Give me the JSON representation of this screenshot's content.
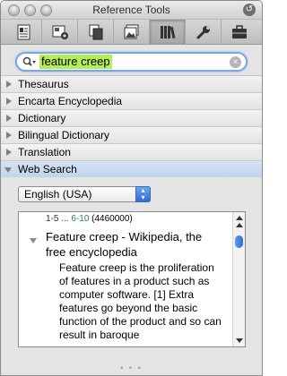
{
  "window": {
    "title": "Reference Tools"
  },
  "toolbar": {
    "tools": [
      {
        "icon": "dictionary-page-icon"
      },
      {
        "icon": "add-entry-icon"
      },
      {
        "icon": "copy-pages-icon"
      },
      {
        "icon": "picture-icon"
      },
      {
        "icon": "library-books-icon",
        "active": true
      },
      {
        "icon": "wrench-icon"
      },
      {
        "icon": "briefcase-icon"
      }
    ]
  },
  "search": {
    "value": "feature creep"
  },
  "sections": {
    "items": [
      {
        "label": "Thesaurus"
      },
      {
        "label": "Encarta Encyclopedia"
      },
      {
        "label": "Dictionary"
      },
      {
        "label": "Bilingual Dictionary"
      },
      {
        "label": "Translation"
      },
      {
        "label": "Web Search"
      }
    ]
  },
  "web_search": {
    "language": "English (USA)",
    "range_current": "1-5",
    "range_ellipsis": "...",
    "range_next": "6-10",
    "total": "(4460000)",
    "result_title": "Feature creep - Wikipedia, the free encyclopedia",
    "result_body": "Feature creep is the proliferation of features in a product such as computer software. [1] Extra features go beyond the basic function of the product and so can result in baroque"
  }
}
